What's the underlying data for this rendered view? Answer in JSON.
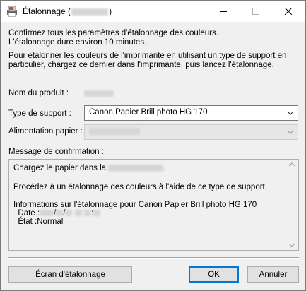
{
  "window": {
    "title": "Étalonnage (",
    "title_suffix": ")",
    "controls": [
      "minimize-icon",
      "maximize-icon",
      "close-icon"
    ]
  },
  "intro": {
    "line1": "Confirmez tous les paramètres d'étalonnage des couleurs.",
    "line2": "L'étalonnage dure environ 10 minutes.",
    "line3": "Pour étalonner les couleurs de l'imprimante en utilisant un type de support en",
    "line4": "particulier, chargez ce dernier dans l'imprimante, puis lancez l'étalonnage."
  },
  "form": {
    "product_label": "Nom du produit :",
    "media_type_label": "Type de support :",
    "media_type_value": "Canon Papier Brill photo HG 170",
    "paper_feed_label": "Alimentation papier :",
    "confirmation_label": "Message de confirmation :"
  },
  "message": {
    "line1_prefix": "Chargez le papier dans la",
    "line1_suffix": ".",
    "line2": "Procédez à un étalonnage des couleurs à l'aide de ce type de support.",
    "line3": "Informations sur l'étalonnage pour Canon Papier Brill photo HG 170",
    "date_label": "Date :",
    "date_sep1": "/",
    "date_sep2": "/",
    "time_sep1": ":",
    "time_sep2": ":",
    "state_label": "État :",
    "state_value": "Normal"
  },
  "buttons": {
    "calibration_screen": "Écran d'étalonnage",
    "ok": "OK",
    "cancel": "Annuler"
  },
  "colors": {
    "focus_border": "#0078d7",
    "dialog_bg": "#f0f0f0"
  }
}
